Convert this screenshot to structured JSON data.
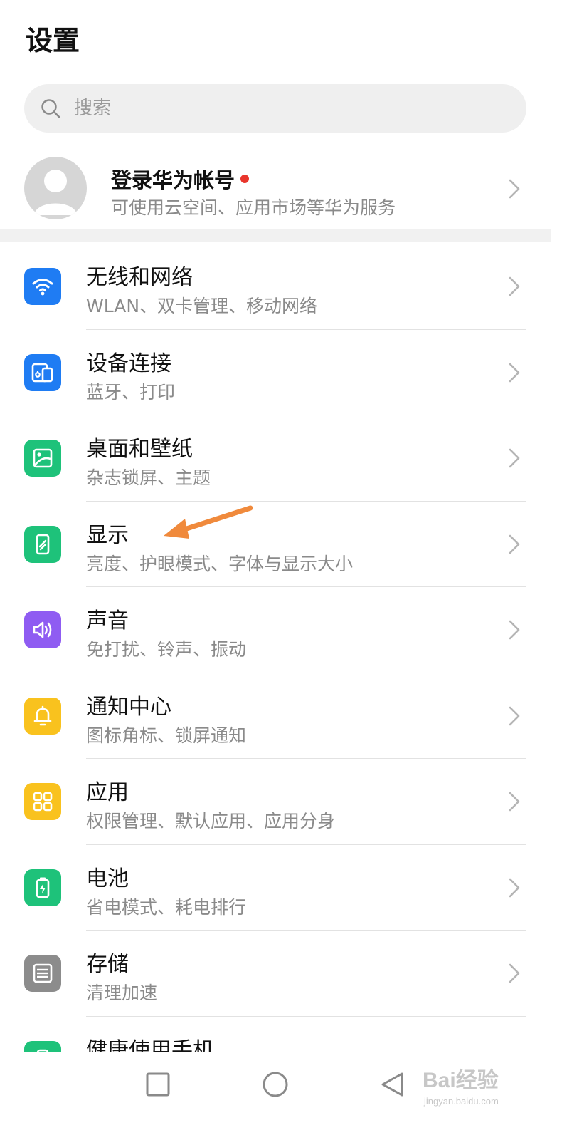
{
  "header": {
    "title": "设置"
  },
  "search": {
    "placeholder": "搜索"
  },
  "account": {
    "name": "登录华为帐号",
    "subtitle": "可使用云空间、应用市场等华为服务"
  },
  "settings": [
    {
      "title": "无线和网络",
      "subtitle": "WLAN、双卡管理、移动网络",
      "icon": "wifi-icon",
      "color": "#1f7cf3"
    },
    {
      "title": "设备连接",
      "subtitle": "蓝牙、打印",
      "icon": "device-connection-icon",
      "color": "#1f7cf3"
    },
    {
      "title": "桌面和壁纸",
      "subtitle": "杂志锁屏、主题",
      "icon": "wallpaper-icon",
      "color": "#1ec27a"
    },
    {
      "title": "显示",
      "subtitle": "亮度、护眼模式、字体与显示大小",
      "icon": "display-icon",
      "color": "#1ec27a"
    },
    {
      "title": "声音",
      "subtitle": "免打扰、铃声、振动",
      "icon": "speaker-icon",
      "color": "#8f5cf2"
    },
    {
      "title": "通知中心",
      "subtitle": "图标角标、锁屏通知",
      "icon": "bell-icon",
      "color": "#f9c21e"
    },
    {
      "title": "应用",
      "subtitle": "权限管理、默认应用、应用分身",
      "icon": "apps-grid-icon",
      "color": "#f9c21e"
    },
    {
      "title": "电池",
      "subtitle": "省电模式、耗电排行",
      "icon": "battery-icon",
      "color": "#1ec27a"
    },
    {
      "title": "存储",
      "subtitle": "清理加速",
      "icon": "storage-icon",
      "color": "#8c8c8c"
    },
    {
      "title": "健康使用手机",
      "subtitle": "",
      "icon": "health-phone-icon",
      "color": "#1ec27a"
    }
  ],
  "watermark": {
    "text": "Bai经验",
    "domain": "jingyan.baidu.com"
  },
  "colors": {
    "accent_dot": "#e9352c",
    "annotation_arrow": "#f08a3c"
  }
}
